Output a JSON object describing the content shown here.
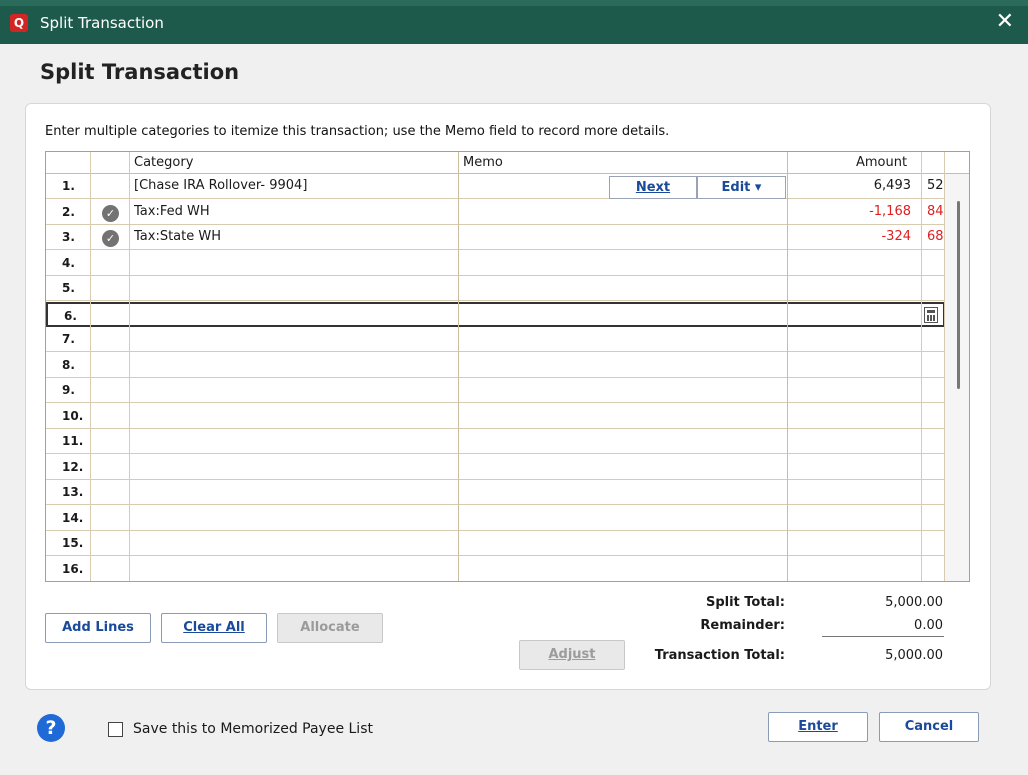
{
  "window": {
    "title": "Split Transaction",
    "app_icon": "Q"
  },
  "dialog": {
    "heading": "Split Transaction",
    "instructions": "Enter multiple categories to itemize this transaction; use the Memo field to record more details."
  },
  "grid": {
    "columns": [
      "Category",
      "Memo",
      "Amount"
    ],
    "rows": [
      {
        "num": "1.",
        "icon": "",
        "category": "[Chase IRA Rollover- 9904]",
        "memo": "",
        "amount": "6,493",
        "cents": "52",
        "negative": false
      },
      {
        "num": "2.",
        "icon": "check-icon",
        "category": "Tax:Fed WH",
        "memo": "",
        "amount": "-1,168",
        "cents": "84",
        "negative": true
      },
      {
        "num": "3.",
        "icon": "check-icon",
        "category": "Tax:State WH",
        "memo": "",
        "amount": "-324",
        "cents": "68",
        "negative": true
      },
      {
        "num": "4.",
        "icon": "",
        "category": "",
        "memo": "",
        "amount": "",
        "cents": "",
        "negative": false
      },
      {
        "num": "5.",
        "icon": "",
        "category": "",
        "memo": "",
        "amount": "",
        "cents": "",
        "negative": false
      },
      {
        "num": "6.",
        "icon": "",
        "category": "",
        "memo": "",
        "amount": "",
        "cents": "",
        "negative": false
      },
      {
        "num": "7.",
        "icon": "",
        "category": "",
        "memo": "",
        "amount": "",
        "cents": "",
        "negative": false
      },
      {
        "num": "8.",
        "icon": "",
        "category": "",
        "memo": "",
        "amount": "",
        "cents": "",
        "negative": false
      },
      {
        "num": "9.",
        "icon": "",
        "category": "",
        "memo": "",
        "amount": "",
        "cents": "",
        "negative": false
      },
      {
        "num": "10.",
        "icon": "",
        "category": "",
        "memo": "",
        "amount": "",
        "cents": "",
        "negative": false
      },
      {
        "num": "11.",
        "icon": "",
        "category": "",
        "memo": "",
        "amount": "",
        "cents": "",
        "negative": false
      },
      {
        "num": "12.",
        "icon": "",
        "category": "",
        "memo": "",
        "amount": "",
        "cents": "",
        "negative": false
      },
      {
        "num": "13.",
        "icon": "",
        "category": "",
        "memo": "",
        "amount": "",
        "cents": "",
        "negative": false
      },
      {
        "num": "14.",
        "icon": "",
        "category": "",
        "memo": "",
        "amount": "",
        "cents": "",
        "negative": false
      },
      {
        "num": "15.",
        "icon": "",
        "category": "",
        "memo": "",
        "amount": "",
        "cents": "",
        "negative": false
      },
      {
        "num": "16.",
        "icon": "",
        "category": "",
        "memo": "",
        "amount": "",
        "cents": "",
        "negative": false
      }
    ],
    "inline_actions": {
      "next": "Next",
      "edit": "Edit ▾"
    }
  },
  "buttons": {
    "add_lines": "Add Lines",
    "clear_all": "Clear All",
    "allocate": "Allocate",
    "adjust": "Adjust",
    "enter": "Enter",
    "cancel": "Cancel"
  },
  "totals": {
    "split_total_label": "Split Total:",
    "split_total": "5,000.00",
    "remainder_label": "Remainder:",
    "remainder": "0.00",
    "transaction_total_label": "Transaction Total:",
    "transaction_total": "5,000.00"
  },
  "footer": {
    "memorize_label": "Save this to Memorized Payee List",
    "memorize_checked": false,
    "help": "?"
  },
  "colors": {
    "titlebar": "#1d5a4b",
    "negative": "#e02020",
    "link": "#1a4a9a",
    "help": "#1f6ad6",
    "app_icon": "#d42525"
  }
}
